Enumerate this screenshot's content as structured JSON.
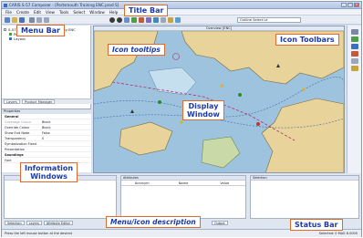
{
  "app": {
    "window_title": "CARIS S-57 Composer - [Portsmouth Training ENC.prod S]",
    "window_buttons": [
      "_",
      "□",
      "x"
    ]
  },
  "menu": [
    "File",
    "Create",
    "Edit",
    "View",
    "Tools",
    "Select",
    "Window",
    "Help"
  ],
  "toolbar": {
    "dropdown_value": "Outline Select Le"
  },
  "tree": {
    "items": [
      "S-57 Product: Portsmouth Training ENC",
      "Portsmouth Training ENC",
      "Layout"
    ]
  },
  "left_tabs": [
    "Layers",
    "Product Manager"
  ],
  "properties": {
    "header": "Properties",
    "rows": [
      {
        "key": "General",
        "value": ""
      },
      {
        "key": "Coverage Colour",
        "value": "Black"
      },
      {
        "key": "Override Colour",
        "value": "Black"
      },
      {
        "key": "Show End Node",
        "value": "False"
      },
      {
        "key": "Transparency",
        "value": "0"
      },
      {
        "key": "Symbolization Fixed",
        "value": ""
      },
      {
        "key": "Presentation",
        "value": ""
      },
      {
        "key": "Soundings",
        "value": ""
      },
      {
        "key": "Font",
        "value": ""
      }
    ]
  },
  "map": {
    "title": "Overview [ENC]"
  },
  "bottom_panes": [
    {
      "header": "",
      "cols": []
    },
    {
      "header": "Attributes",
      "cols": [
        "Acronym",
        "Name",
        "Value"
      ]
    },
    {
      "header": "Selection",
      "cols": []
    }
  ],
  "bottom_tabs": [
    "Selection",
    "Layers",
    "Attribute Editor",
    "Output"
  ],
  "status": {
    "left": "Press the left mouse button at the desired",
    "right": "Selected: 0   MAG 8.0000"
  },
  "callouts": {
    "title_bar": "Title Bar",
    "menu_bar": "Menu Bar",
    "icon_tooltips": "Icon tooltips",
    "icon_toolbars": "Icon Toolbars",
    "display_window": "Display\nWindow",
    "information_windows": "Information\nWindows",
    "menu_icon_description": "Menu/icon description",
    "status_bar": "Status Bar"
  },
  "colors": {
    "callout_border": "#e06a2e",
    "callout_text": "#1c3aa8",
    "sea": "#9dc3df",
    "land": "#e8d49a"
  }
}
